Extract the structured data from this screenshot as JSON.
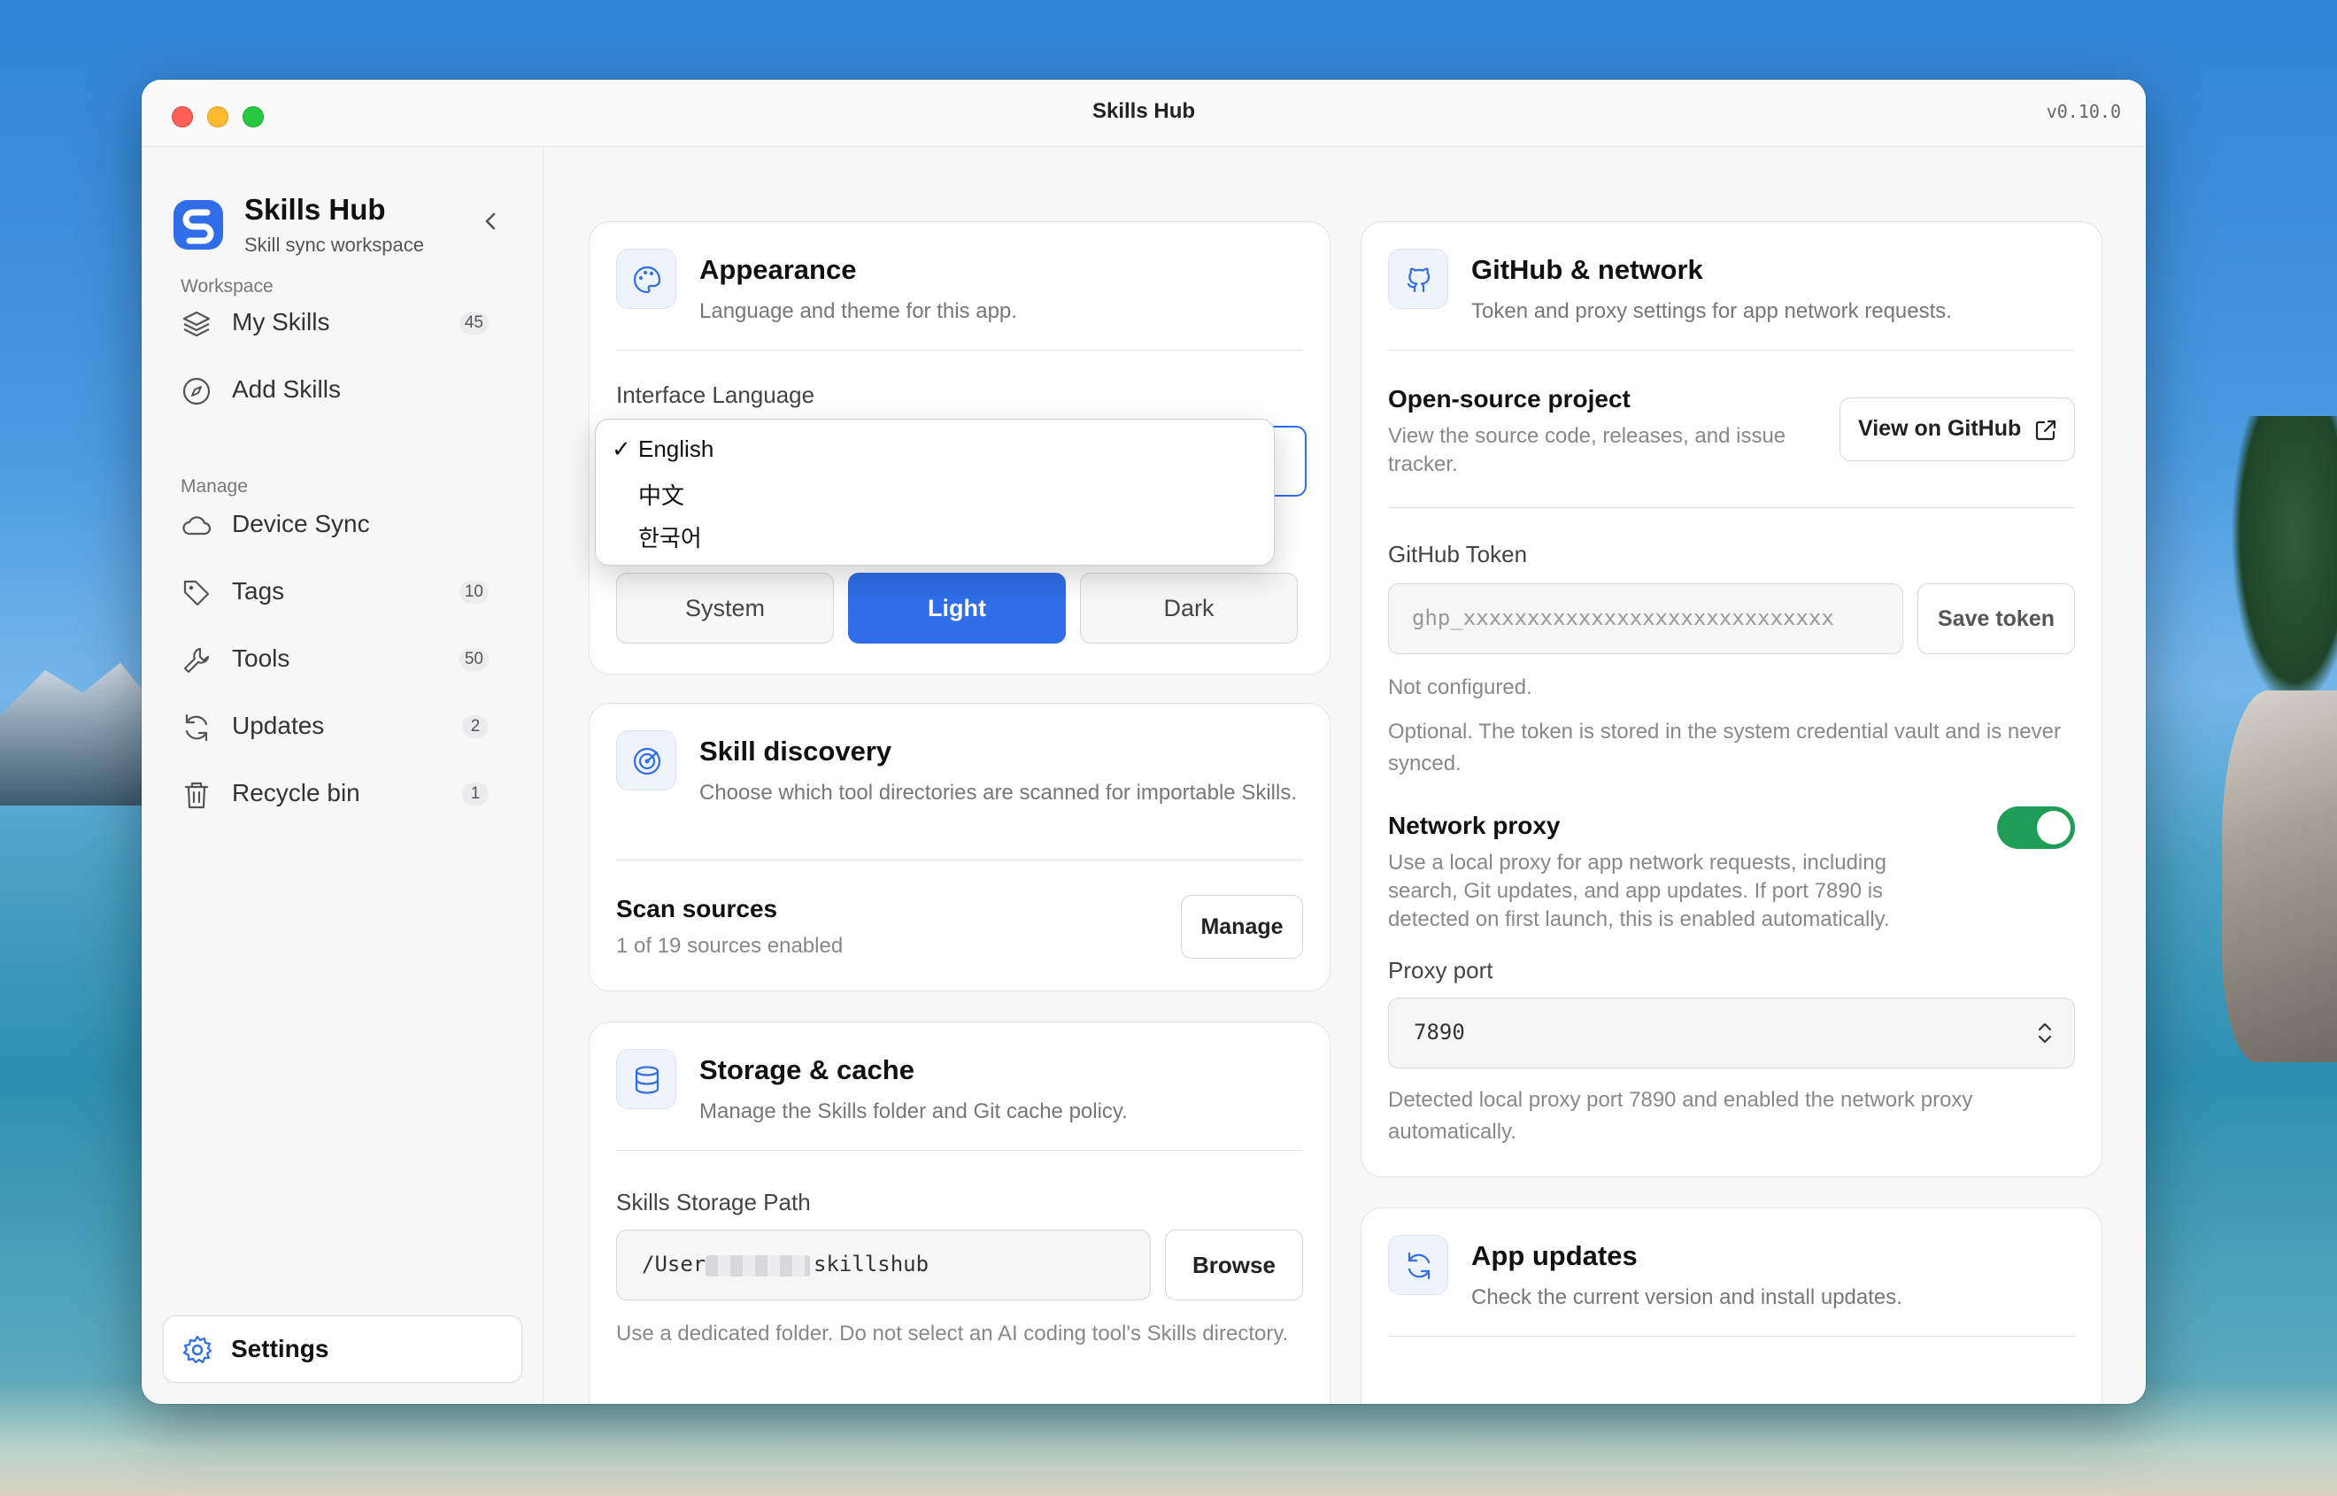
{
  "window": {
    "title": "Skills Hub",
    "version": "v0.10.0"
  },
  "sidebar": {
    "brand_name": "Skills Hub",
    "brand_sub": "Skill sync workspace",
    "workspace_label": "Workspace",
    "manage_label": "Manage",
    "workspace_items": [
      {
        "label": "My Skills",
        "badge": "45",
        "icon": "layers-icon"
      },
      {
        "label": "Add Skills",
        "badge": "",
        "icon": "compass-icon"
      }
    ],
    "manage_items": [
      {
        "label": "Device Sync",
        "badge": "",
        "icon": "cloud-icon"
      },
      {
        "label": "Tags",
        "badge": "10",
        "icon": "tag-icon"
      },
      {
        "label": "Tools",
        "badge": "50",
        "icon": "wrench-icon"
      },
      {
        "label": "Updates",
        "badge": "2",
        "icon": "refresh-icon"
      },
      {
        "label": "Recycle bin",
        "badge": "1",
        "icon": "trash-icon"
      }
    ],
    "settings_label": "Settings"
  },
  "appearance": {
    "title": "Appearance",
    "subtitle": "Language and theme for this app.",
    "language_label": "Interface Language",
    "language_options": [
      {
        "label": "English",
        "selected": true
      },
      {
        "label": "中文",
        "selected": false
      },
      {
        "label": "한국어",
        "selected": false
      }
    ],
    "check_mark": "✓",
    "theme_options": [
      "System",
      "Light",
      "Dark"
    ],
    "active_theme": "Light"
  },
  "discovery": {
    "title": "Skill discovery",
    "subtitle": "Choose which tool directories are scanned for importable Skills.",
    "scan_title": "Scan sources",
    "scan_sub": "1 of 19 sources enabled",
    "manage_button": "Manage"
  },
  "storage": {
    "title": "Storage & cache",
    "subtitle": "Manage the Skills folder and Git cache policy.",
    "path_label": "Skills Storage Path",
    "path_prefix": "/User",
    "path_suffix": "skillshub",
    "browse_button": "Browse",
    "hint": "Use a dedicated folder. Do not select an AI coding tool's Skills directory."
  },
  "github": {
    "title": "GitHub & network",
    "subtitle": "Token and proxy settings for app network requests.",
    "oss_title": "Open-source project",
    "oss_sub": "View the source code, releases, and issue tracker.",
    "view_button": "View on GitHub",
    "token_label": "GitHub Token",
    "token_value": "ghp_xxxxxxxxxxxxxxxxxxxxxxxxxxxxx",
    "save_button": "Save token",
    "token_status": "Not configured.",
    "token_hint": "Optional. The token is stored in the system credential vault and is never synced.",
    "proxy_title": "Network proxy",
    "proxy_sub": "Use a local proxy for app network requests, including search, Git updates, and app updates. If port 7890 is detected on first launch, this is enabled automatically.",
    "proxy_enabled": true,
    "proxy_port_label": "Proxy port",
    "proxy_port": "7890",
    "proxy_status": "Detected local proxy port 7890 and enabled the network proxy automatically."
  },
  "updates": {
    "title": "App updates",
    "subtitle": "Check the current version and install updates."
  },
  "colors": {
    "accent": "#2f6ee8",
    "toggle_on": "#1f9d57",
    "brand": "#2f6ee8"
  }
}
